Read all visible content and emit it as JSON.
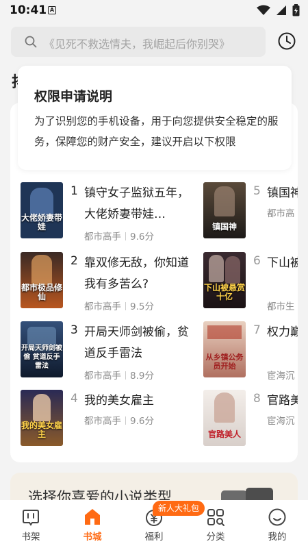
{
  "status_bar": {
    "time": "10:41",
    "notif_label": "A"
  },
  "search": {
    "placeholder": "《见死不救选情夫，我崛起后你别哭》"
  },
  "hidden_heading_char": "排",
  "permission_popup": {
    "title": "权限申请说明",
    "description": "为了识别您的手机设备，用于向您提供安全稳定的服务，保障您的财产安全，建议开启以下权限"
  },
  "books": [
    {
      "rank": "1",
      "title": "镇守女子监狱五年，大佬娇妻带娃…",
      "category": "都市高手",
      "score": "9.6分",
      "cover_text": "大佬娇妻带娃",
      "cover_color": "#1f3556"
    },
    {
      "rank": "2",
      "title": "靠双修无敌，你知道我有多苦么?",
      "category": "都市高手",
      "score": "9.5分",
      "cover_text": "都市极品修仙",
      "cover_color": "#7a3a1a"
    },
    {
      "rank": "3",
      "title": "开局天师剑被偷，贫道反手雷法",
      "category": "都市高手",
      "score": "8.9分",
      "cover_text": "开局天师剑被偷 贫道反手雷法",
      "cover_color": "#1c2b45"
    },
    {
      "rank": "4",
      "title": "我的美女雇主",
      "category": "都市高手",
      "score": "9.6分",
      "cover_text": "我的美女雇主",
      "cover_color": "#2a2a55"
    },
    {
      "rank": "5",
      "title": "镇国神",
      "category": "都市高",
      "score": "",
      "cover_text": "镇国神",
      "cover_color": "#3a3128"
    },
    {
      "rank": "6",
      "title": "下山被十亿赏",
      "category": "都市生",
      "score": "",
      "cover_text": "下山被悬赏十亿",
      "cover_color": "#2b1f24"
    },
    {
      "rank": "7",
      "title": "权力巅公务员",
      "category": "宦海沉",
      "score": "",
      "cover_text": "从乡镇公务员开始",
      "cover_color": "#c9a892"
    },
    {
      "rank": "8",
      "title": "官路美",
      "category": "宦海沉",
      "score": "",
      "cover_text": "官路美人",
      "cover_color": "#e9e2df"
    }
  ],
  "genre_banner": {
    "text": "选择你喜爱的小说类型"
  },
  "tabbar": {
    "tabs": [
      {
        "label": "书架",
        "icon": "bookshelf-icon"
      },
      {
        "label": "书城",
        "icon": "bookstore-icon"
      },
      {
        "label": "福利",
        "icon": "welfare-icon"
      },
      {
        "label": "分类",
        "icon": "category-icon"
      },
      {
        "label": "我的",
        "icon": "profile-icon"
      }
    ],
    "active": "书城",
    "badge": "新人大礼包"
  },
  "colors": {
    "accent": "#ff6a13",
    "background": "#f3f3f3",
    "card": "#ffffff"
  }
}
